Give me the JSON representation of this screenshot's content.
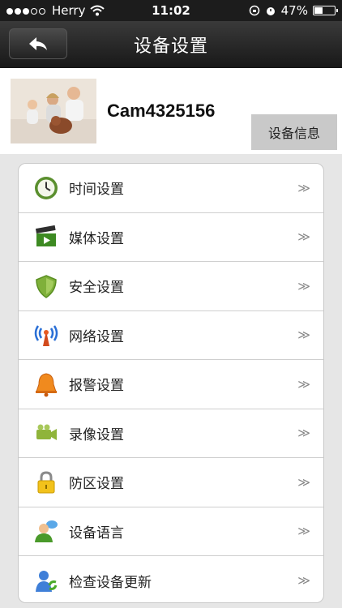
{
  "status_bar": {
    "carrier": "Herry",
    "time": "11:02",
    "battery": "47%",
    "battery_level": 0.47
  },
  "navbar": {
    "title": "设备设置",
    "back_icon": "back-arrow-icon"
  },
  "device": {
    "name": "Cam4325156",
    "info_button": "设备信息"
  },
  "menu": {
    "items": [
      {
        "label": "时间设置",
        "icon": "clock-icon"
      },
      {
        "label": "媒体设置",
        "icon": "clapper-icon"
      },
      {
        "label": "安全设置",
        "icon": "shield-icon"
      },
      {
        "label": "网络设置",
        "icon": "antenna-icon"
      },
      {
        "label": "报警设置",
        "icon": "bell-icon"
      },
      {
        "label": "录像设置",
        "icon": "video-camera-icon"
      },
      {
        "label": "防区设置",
        "icon": "lock-icon"
      },
      {
        "label": "设备语言",
        "icon": "user-chat-icon"
      },
      {
        "label": "检查设备更新",
        "icon": "update-user-icon"
      }
    ],
    "chevron": "≫"
  }
}
